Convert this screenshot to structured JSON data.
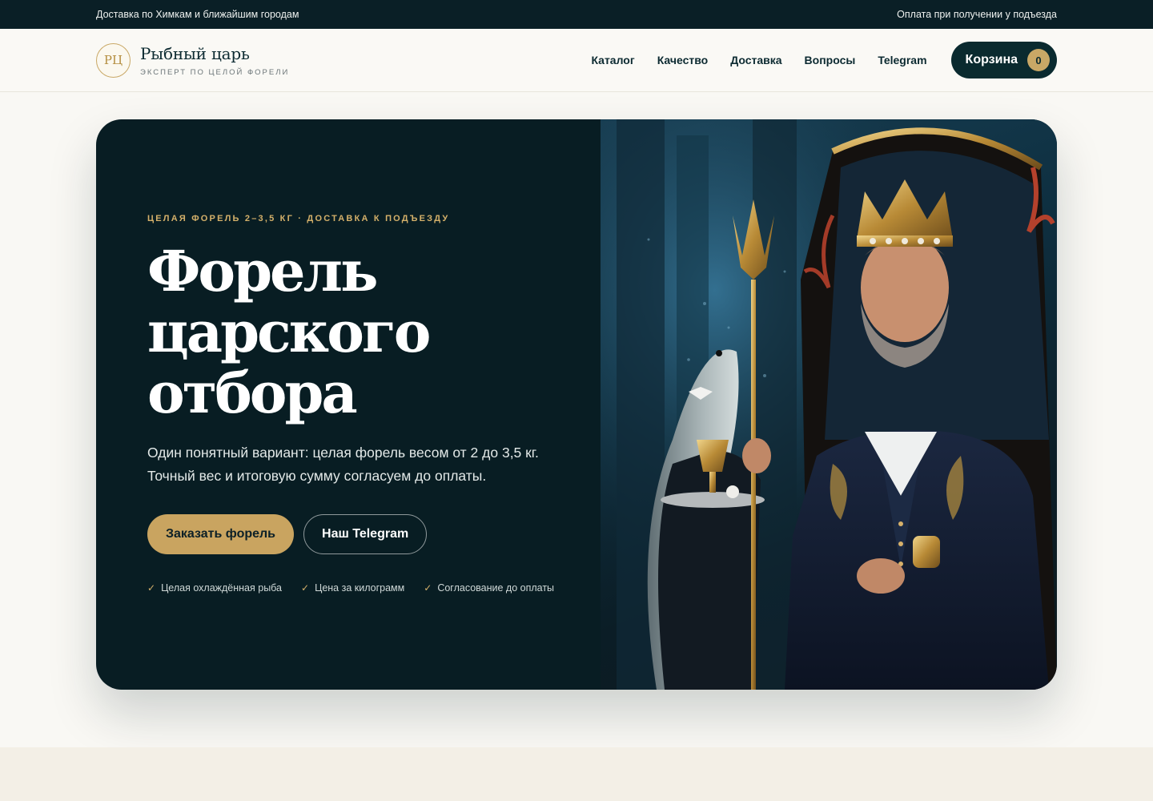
{
  "topbar": {
    "left": "Доставка по Химкам и ближайшим городам",
    "right": "Оплата при получении у подъезда"
  },
  "header": {
    "logo_mark": "РЦ",
    "brand_name": "Рыбный царь",
    "tagline": "ЭКСПЕРТ ПО ЦЕЛОЙ ФОРЕЛИ",
    "nav": [
      "Каталог",
      "Качество",
      "Доставка",
      "Вопросы",
      "Telegram"
    ],
    "cart_label": "Корзина",
    "cart_count": "0"
  },
  "hero": {
    "eyebrow": "ЦЕЛАЯ ФОРЕЛЬ 2–3,5 КГ · ДОСТАВКА К ПОДЪЕЗДУ",
    "title_lines": [
      "Форель",
      "царского",
      "отбора"
    ],
    "lead_lines": [
      "Один понятный вариант: целая форель весом от 2 до 3,5 кг.",
      "Точный вес и итоговую сумму согласуем до оплаты."
    ],
    "primary_cta": "Заказать форель",
    "secondary_cta": "Наш Telegram",
    "features": [
      "Целая охлаждённая рыба",
      "Цена за килограмм",
      "Согласование до оплаты"
    ]
  },
  "colors": {
    "dark": "#0a1f26",
    "gold": "#c9a460",
    "page_bg": "#f9f8f4"
  }
}
